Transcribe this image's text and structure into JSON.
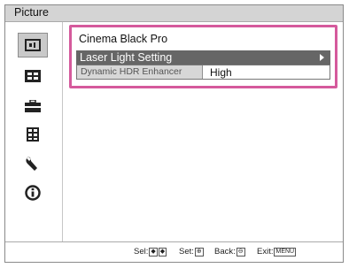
{
  "window": {
    "title": "Picture"
  },
  "sidebar": {
    "items": [
      {
        "icon": "picture-icon",
        "selected": true
      },
      {
        "icon": "screen-icon"
      },
      {
        "icon": "setup-icon"
      },
      {
        "icon": "function-icon"
      },
      {
        "icon": "wrench-icon"
      },
      {
        "icon": "information-icon"
      }
    ]
  },
  "panel": {
    "title": "Cinema Black Pro",
    "selected_item": "Laser Light Setting",
    "sub_item": {
      "name": "Dynamic HDR Enhancer",
      "value": "High"
    }
  },
  "footer": {
    "hints": [
      {
        "label": "Sel:",
        "keys": [
          "◆",
          "◆"
        ]
      },
      {
        "label": "Set:",
        "keys": [
          "⊕"
        ]
      },
      {
        "label": "Back:",
        "keys": [
          "⊖"
        ]
      },
      {
        "label": "Exit:",
        "keys": [
          "MENU"
        ]
      }
    ]
  },
  "colors": {
    "highlight_border": "#d55a9c",
    "selected_row": "#666666",
    "titlebar": "#d4d4d4"
  }
}
